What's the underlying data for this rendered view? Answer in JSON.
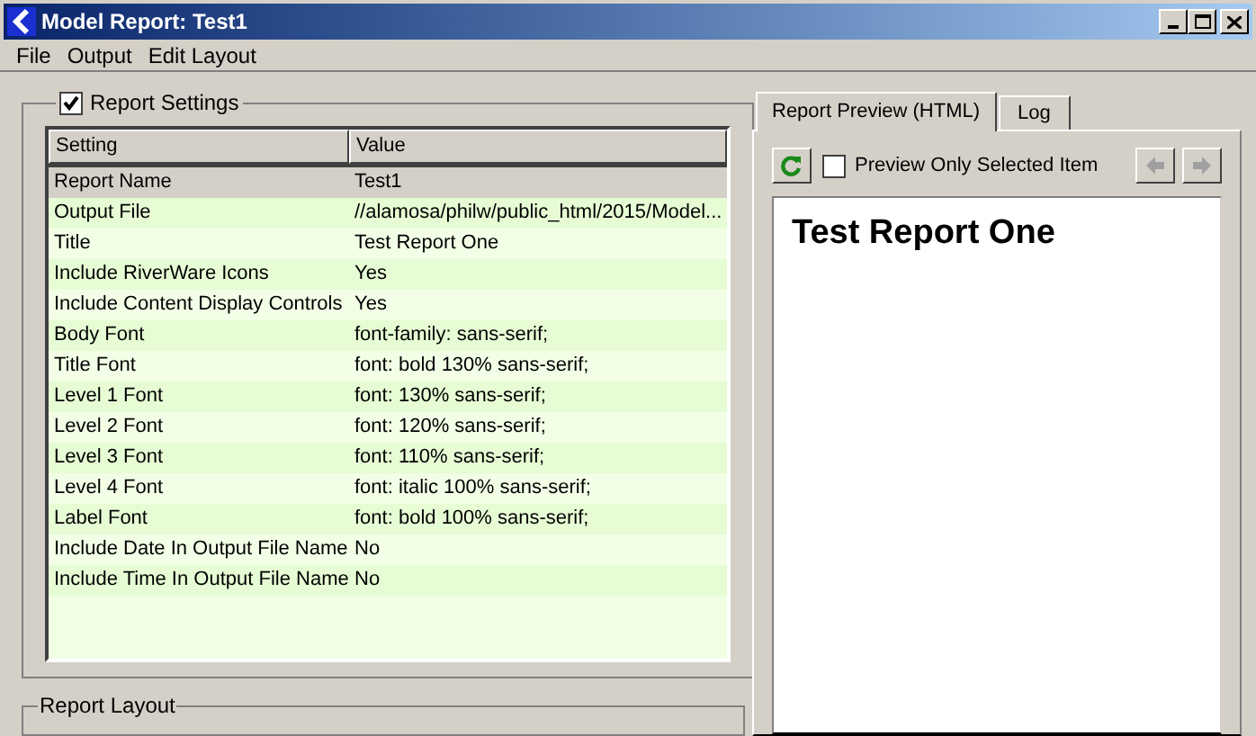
{
  "window": {
    "title": "Model Report: Test1"
  },
  "menu": [
    "File",
    "Output",
    "Edit Layout"
  ],
  "report_settings": {
    "label": "Report Settings",
    "checked": true,
    "columns": [
      "Setting",
      "Value"
    ],
    "rows": [
      {
        "setting": "Report Name",
        "value": "Test1",
        "selected": true
      },
      {
        "setting": "Output File",
        "value": "//alamosa/philw/public_html/2015/Model...",
        "selected": false
      },
      {
        "setting": "Title",
        "value": "Test Report One",
        "selected": false
      },
      {
        "setting": "Include RiverWare Icons",
        "value": "Yes",
        "selected": false
      },
      {
        "setting": "Include Content Display Controls",
        "value": "Yes",
        "selected": false
      },
      {
        "setting": "Body Font",
        "value": "font-family: sans-serif;",
        "selected": false
      },
      {
        "setting": "Title Font",
        "value": "font: bold 130% sans-serif;",
        "selected": false
      },
      {
        "setting": "Level 1 Font",
        "value": "font: 130% sans-serif;",
        "selected": false
      },
      {
        "setting": "Level 2 Font",
        "value": "font: 120% sans-serif;",
        "selected": false
      },
      {
        "setting": "Level 3 Font",
        "value": "font: 110% sans-serif;",
        "selected": false
      },
      {
        "setting": "Level 4 Font",
        "value": "font: italic 100% sans-serif;",
        "selected": false
      },
      {
        "setting": "Label Font",
        "value": "font: bold 100% sans-serif;",
        "selected": false
      },
      {
        "setting": "Include Date In Output File Name",
        "value": "No",
        "selected": false
      },
      {
        "setting": "Include Time In Output File Name",
        "value": "No",
        "selected": false
      }
    ]
  },
  "report_layout": {
    "label": "Report Layout"
  },
  "tabs": [
    {
      "label": "Report Preview (HTML)",
      "selected": true
    },
    {
      "label": "Log",
      "selected": false
    }
  ],
  "preview": {
    "only_selected": {
      "label": "Preview Only Selected Item",
      "checked": false
    },
    "back_disabled": true,
    "forward_disabled": true,
    "heading": "Test Report One"
  }
}
